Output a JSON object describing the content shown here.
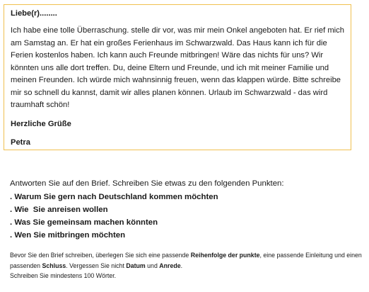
{
  "letter": {
    "salutation": "Liebe(r)........",
    "body": "Ich habe eine tolle Überraschung. stelle dir vor, was mir mein Onkel angeboten hat. Er rief mich am Samstag an. Er hat ein großes Ferienhaus im Schwarzwald. Das Haus kann ich für die Ferien kostenlos haben. Ich kann auch Freunde mitbringen! Wäre das nichts für uns? Wir könnten uns alle dort treffen. Du, deine Eltern und Freunde, und ich mit meiner Familie und meinen Freunden. Ich würde mich wahnsinnig freuen, wenn das klappen würde. Bitte schreibe mir so schnell du kannst, damit wir alles planen können. Urlaub im Schwarzwald - das wird traumhaft schön!",
    "closing": "Herzliche Grüße",
    "signature": "Petra"
  },
  "task": {
    "intro": "Antworten Sie auf den Brief. Schreiben Sie etwas zu den folgenden Punkten:",
    "points": [
      ". Warum Sie gern nach Deutschland kommen möchten",
      ". Wie  Sie anreisen wollen",
      ". Was Sie gemeinsam machen könnten",
      ". Wen Sie mitbringen möchten"
    ]
  },
  "instructions": {
    "part1": "Bevor Sie den Brief schreiben, überlegen Sie sich eine passende ",
    "bold1": "Reihenfolge der punkte",
    "part2": ", eine passende Einleitung und einen passenden ",
    "bold2": "Schluss",
    "part3": ". Vergessen Sie nicht ",
    "bold3": "Datum",
    "part4": " und ",
    "bold4": "Anrede",
    "part5": ".",
    "line2": "Schreiben Sie mindestens 100 Wörter."
  },
  "colors": {
    "box_border": "#f0c050",
    "text": "#1a1a1a"
  }
}
